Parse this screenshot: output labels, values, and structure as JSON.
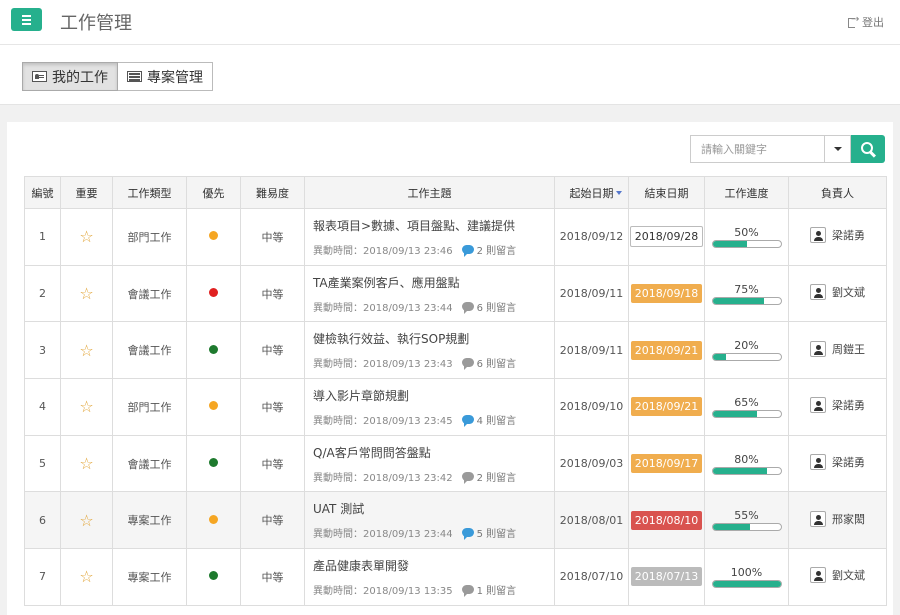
{
  "app": {
    "title": "工作管理",
    "logout_label": "登出"
  },
  "tabs": [
    {
      "label": "我的工作",
      "active": true,
      "icon": "id-card-icon"
    },
    {
      "label": "專案管理",
      "active": false,
      "icon": "list-icon"
    }
  ],
  "search": {
    "placeholder": "請輸入關鍵字"
  },
  "table": {
    "headers": {
      "id": "編號",
      "important": "重要",
      "type": "工作類型",
      "priority": "優先",
      "difficulty": "難易度",
      "subject": "工作主題",
      "start": "起始日期",
      "end": "結束日期",
      "progress": "工作進度",
      "owner": "負責人"
    },
    "sort_column": "start",
    "rows": [
      {
        "id": "1",
        "type": "部門工作",
        "priority_color": "#f5a623",
        "difficulty": "中等",
        "title": "報表項目>數據、項目盤點、建議提供",
        "updated": "異動時間：2018/09/13 23:46",
        "comments": "2 則留言",
        "comment_color": "blue",
        "start": "2018/09/12",
        "end": "2018/09/28",
        "end_style": "plain",
        "progress_label": "50%",
        "progress": 0.5,
        "owner": "梁諾勇"
      },
      {
        "id": "2",
        "type": "會議工作",
        "priority_color": "#e02020",
        "difficulty": "中等",
        "title": "TA產業案例客戶、應用盤點",
        "updated": "異動時間：2018/09/13 23:44",
        "comments": "6 則留言",
        "comment_color": "grey",
        "start": "2018/09/11",
        "end": "2018/09/18",
        "end_style": "orange",
        "progress_label": "75%",
        "progress": 0.75,
        "owner": "劉文斌"
      },
      {
        "id": "3",
        "type": "會議工作",
        "priority_color": "#1e7a2e",
        "difficulty": "中等",
        "title": "健檢執行效益、執行SOP規劃",
        "updated": "異動時間：2018/09/13 23:43",
        "comments": "6 則留言",
        "comment_color": "grey",
        "start": "2018/09/11",
        "end": "2018/09/21",
        "end_style": "orange",
        "progress_label": "20%",
        "progress": 0.2,
        "owner": "周鎧王"
      },
      {
        "id": "4",
        "type": "部門工作",
        "priority_color": "#f5a623",
        "difficulty": "中等",
        "title": "導入影片章節規劃",
        "updated": "異動時間：2018/09/13 23:45",
        "comments": "4 則留言",
        "comment_color": "blue",
        "start": "2018/09/10",
        "end": "2018/09/21",
        "end_style": "orange",
        "progress_label": "65%",
        "progress": 0.65,
        "owner": "梁諾勇"
      },
      {
        "id": "5",
        "type": "會議工作",
        "priority_color": "#1e7a2e",
        "difficulty": "中等",
        "title": "Q/A客戶常問問答盤點",
        "updated": "異動時間：2018/09/13 23:42",
        "comments": "2 則留言",
        "comment_color": "grey",
        "start": "2018/09/03",
        "end": "2018/09/17",
        "end_style": "orange",
        "progress_label": "80%",
        "progress": 0.8,
        "owner": "梁諾勇"
      },
      {
        "id": "6",
        "type": "專案工作",
        "priority_color": "#f5a623",
        "difficulty": "中等",
        "title": "UAT 測試",
        "updated": "異動時間：2018/09/13 23:44",
        "comments": "5 則留言",
        "comment_color": "blue",
        "start": "2018/08/01",
        "end": "2018/08/10",
        "end_style": "red",
        "progress_label": "55%",
        "progress": 0.55,
        "owner": "邢家閎"
      },
      {
        "id": "7",
        "type": "專案工作",
        "priority_color": "#1e7a2e",
        "difficulty": "中等",
        "title": "產品健康表單開發",
        "updated": "異動時間：2018/09/13 13:35",
        "comments": "1 則留言",
        "comment_color": "grey",
        "start": "2018/07/10",
        "end": "2018/07/13",
        "end_style": "grey",
        "progress_label": "100%",
        "progress": 1.0,
        "owner": "劉文斌"
      }
    ]
  }
}
